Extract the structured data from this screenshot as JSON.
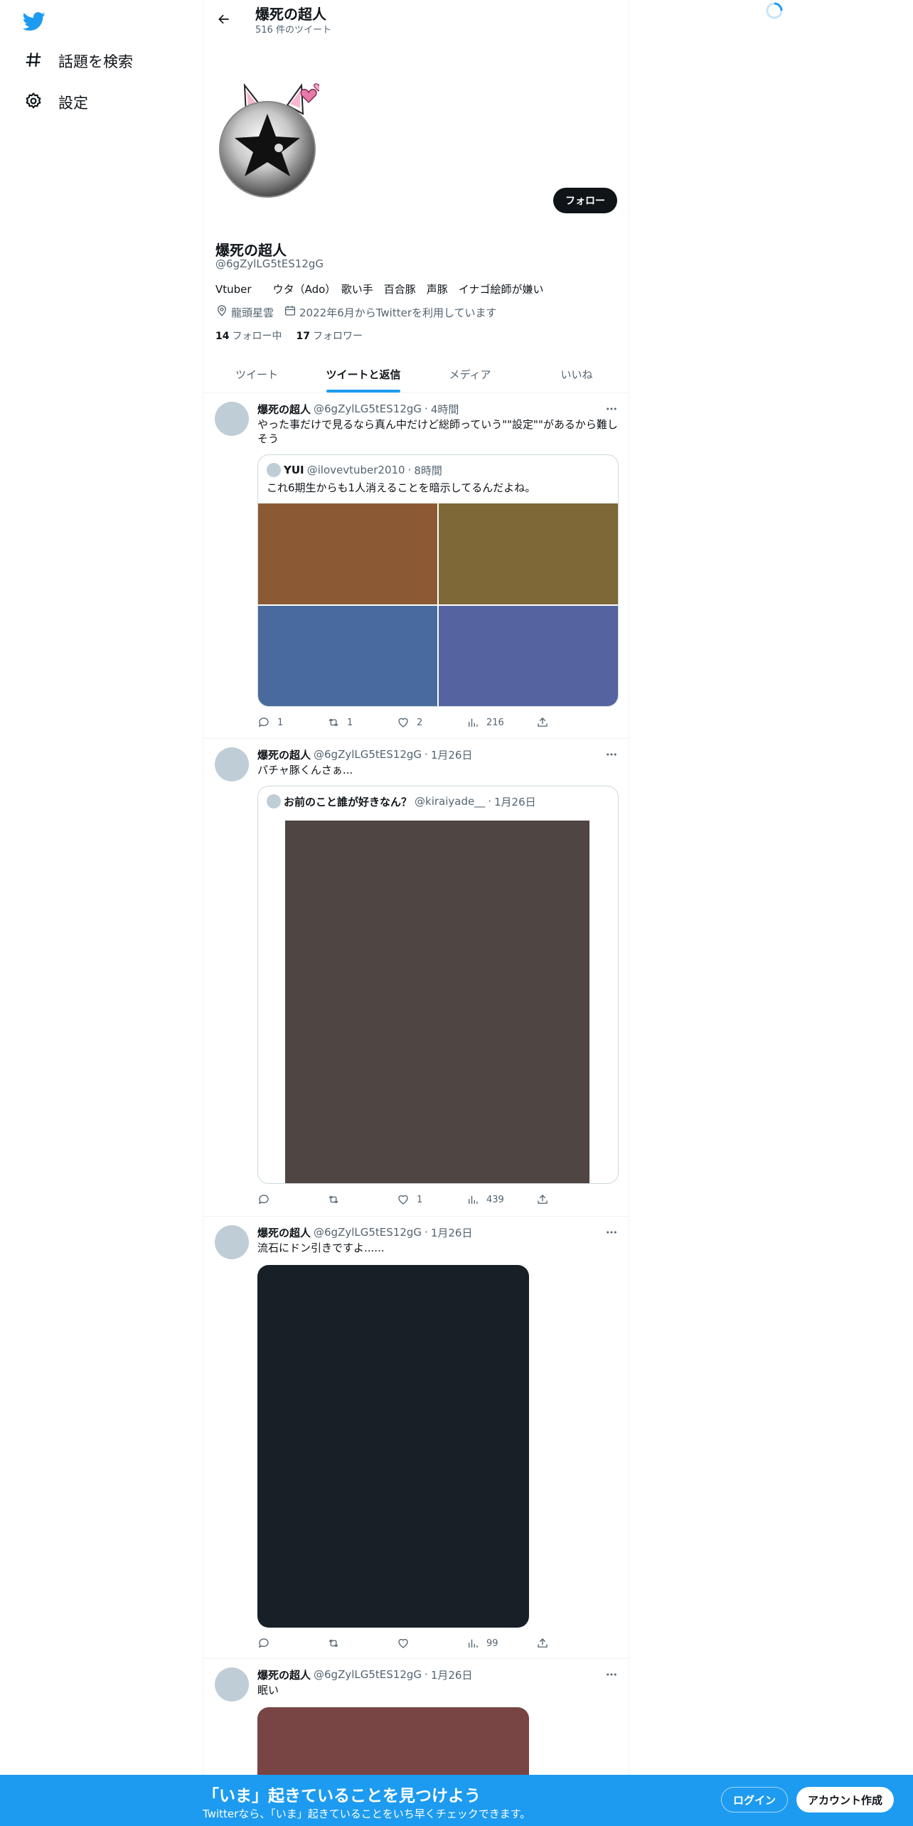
{
  "nav": {
    "logo": "twitter-bird-icon",
    "items": [
      {
        "label": "話題を検索",
        "icon": "hashtag-icon"
      },
      {
        "label": "設定",
        "icon": "gear-icon"
      }
    ]
  },
  "header": {
    "title": "爆死の超人",
    "subtitle": "516 件のツイート"
  },
  "profile": {
    "name": "爆死の超人",
    "handle": "@6gZylLG5tES12gG",
    "bio": "Vtuber　　ウタ（Ado）　歌い手　百合豚　声豚　イナゴ絵師が嫌い",
    "location": "龍頭星雲",
    "joined": "2022年6月からTwitterを利用しています",
    "following_count": "14",
    "following_label": "フォロー中",
    "followers_count": "17",
    "followers_label": "フォロワー",
    "follow_button": "フォロー"
  },
  "tabs": [
    {
      "label": "ツイート",
      "active": false
    },
    {
      "label": "ツイートと返信",
      "active": true
    },
    {
      "label": "メディア",
      "active": false
    },
    {
      "label": "いいね",
      "active": false
    }
  ],
  "tweets": [
    {
      "name": "爆死の超人",
      "handle": "@6gZylLG5tES12gG",
      "time": "4時間",
      "text": "やった事だけで見るなら真ん中だけど総師っていう\"\"設定\"\"があるから難しそう",
      "quote": {
        "name": "YUI",
        "handle": "@ilovevtuber2010",
        "time": "8時間",
        "text": "これ6期生からも1人消えることを暗示してるんだよね。",
        "image_colors": [
          "#8b5a34",
          "#7e6838",
          "#486a9c",
          "#5563a0"
        ]
      },
      "stats": {
        "replies": "1",
        "retweets": "1",
        "likes": "2",
        "views": "216"
      }
    },
    {
      "name": "爆死の超人",
      "handle": "@6gZylLG5tES12gG",
      "time": "1月26日",
      "text": "パチャ豚くんさぁ...",
      "quote": {
        "name": "お前のこと誰が好きなん？",
        "handle": "@kiraiyade__",
        "time": "1月26日",
        "image_color": "#4f4543"
      },
      "stats": {
        "replies": "",
        "retweets": "",
        "likes": "1",
        "views": "439"
      }
    },
    {
      "name": "爆死の超人",
      "handle": "@6gZylLG5tES12gG",
      "time": "1月26日",
      "text": "流石にドン引きですよ......",
      "image_color": "#171f27",
      "stats": {
        "replies": "",
        "retweets": "",
        "likes": "",
        "views": "99"
      }
    },
    {
      "name": "爆死の超人",
      "handle": "@6gZylLG5tES12gG",
      "time": "1月26日",
      "text": "眠い",
      "image_color": "#784444"
    }
  ],
  "bottom": {
    "title": "「いま」起きていることを見つけよう",
    "subtitle": "Twitterなら、「いま」起きていることをいち早くチェックできます。",
    "login": "ログイン",
    "signup": "アカウント作成"
  },
  "colors": {
    "accent": "#1d9bf0",
    "text": "#0f1419",
    "muted": "#536471"
  }
}
